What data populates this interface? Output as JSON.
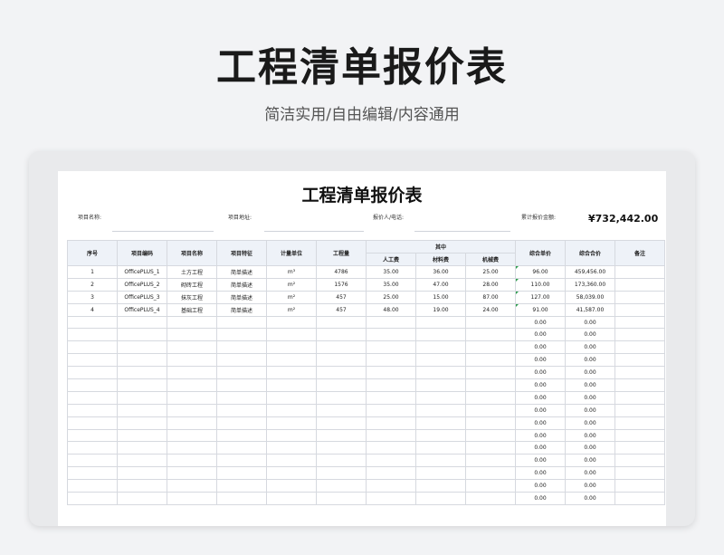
{
  "hero": {
    "title": "工程清单报价表",
    "subtitle": "简洁实用/自由编辑/内容通用"
  },
  "sheet": {
    "title": "工程清单报价表",
    "project_name_label": "项目名称:",
    "project_address_label": "项目地址:",
    "quoter_label": "报价人/电话:",
    "total_label": "累计报价金额:",
    "total_value": "¥732,442.00"
  },
  "table": {
    "headers": {
      "seq": "序号",
      "code": "项目编码",
      "name": "项目名称",
      "feature": "项目特征",
      "unit": "计量单位",
      "qty": "工程量",
      "among": "其中",
      "labor": "人工费",
      "material": "材料费",
      "machine": "机械费",
      "unit_price": "综合单价",
      "total_price": "综合合价",
      "note": "备注"
    },
    "rows": [
      [
        "1",
        "OfficePLUS_1",
        "土方工程",
        "简单描述",
        "m³",
        "4786",
        "35.00",
        "36.00",
        "25.00",
        "96.00",
        "459,456.00",
        ""
      ],
      [
        "2",
        "OfficePLUS_2",
        "砌砖工程",
        "简单描述",
        "m²",
        "1576",
        "35.00",
        "47.00",
        "28.00",
        "110.00",
        "173,360.00",
        ""
      ],
      [
        "3",
        "OfficePLUS_3",
        "抹灰工程",
        "简单描述",
        "m²",
        "457",
        "25.00",
        "15.00",
        "87.00",
        "127.00",
        "58,039.00",
        ""
      ],
      [
        "4",
        "OfficePLUS_4",
        "基础工程",
        "简单描述",
        "m²",
        "457",
        "48.00",
        "19.00",
        "24.00",
        "91.00",
        "41,587.00",
        ""
      ],
      [
        "",
        "",
        "",
        "",
        "",
        "",
        "",
        "",
        "",
        "0.00",
        "0.00",
        ""
      ],
      [
        "",
        "",
        "",
        "",
        "",
        "",
        "",
        "",
        "",
        "0.00",
        "0.00",
        ""
      ],
      [
        "",
        "",
        "",
        "",
        "",
        "",
        "",
        "",
        "",
        "0.00",
        "0.00",
        ""
      ],
      [
        "",
        "",
        "",
        "",
        "",
        "",
        "",
        "",
        "",
        "0.00",
        "0.00",
        ""
      ],
      [
        "",
        "",
        "",
        "",
        "",
        "",
        "",
        "",
        "",
        "0.00",
        "0.00",
        ""
      ],
      [
        "",
        "",
        "",
        "",
        "",
        "",
        "",
        "",
        "",
        "0.00",
        "0.00",
        ""
      ],
      [
        "",
        "",
        "",
        "",
        "",
        "",
        "",
        "",
        "",
        "0.00",
        "0.00",
        ""
      ],
      [
        "",
        "",
        "",
        "",
        "",
        "",
        "",
        "",
        "",
        "0.00",
        "0.00",
        ""
      ],
      [
        "",
        "",
        "",
        "",
        "",
        "",
        "",
        "",
        "",
        "0.00",
        "0.00",
        ""
      ],
      [
        "",
        "",
        "",
        "",
        "",
        "",
        "",
        "",
        "",
        "0.00",
        "0.00",
        ""
      ],
      [
        "",
        "",
        "",
        "",
        "",
        "",
        "",
        "",
        "",
        "0.00",
        "0.00",
        ""
      ],
      [
        "",
        "",
        "",
        "",
        "",
        "",
        "",
        "",
        "",
        "0.00",
        "0.00",
        ""
      ],
      [
        "",
        "",
        "",
        "",
        "",
        "",
        "",
        "",
        "",
        "0.00",
        "0.00",
        ""
      ],
      [
        "",
        "",
        "",
        "",
        "",
        "",
        "",
        "",
        "",
        "0.00",
        "0.00",
        ""
      ],
      [
        "",
        "",
        "",
        "",
        "",
        "",
        "",
        "",
        "",
        "0.00",
        "0.00",
        ""
      ]
    ]
  }
}
